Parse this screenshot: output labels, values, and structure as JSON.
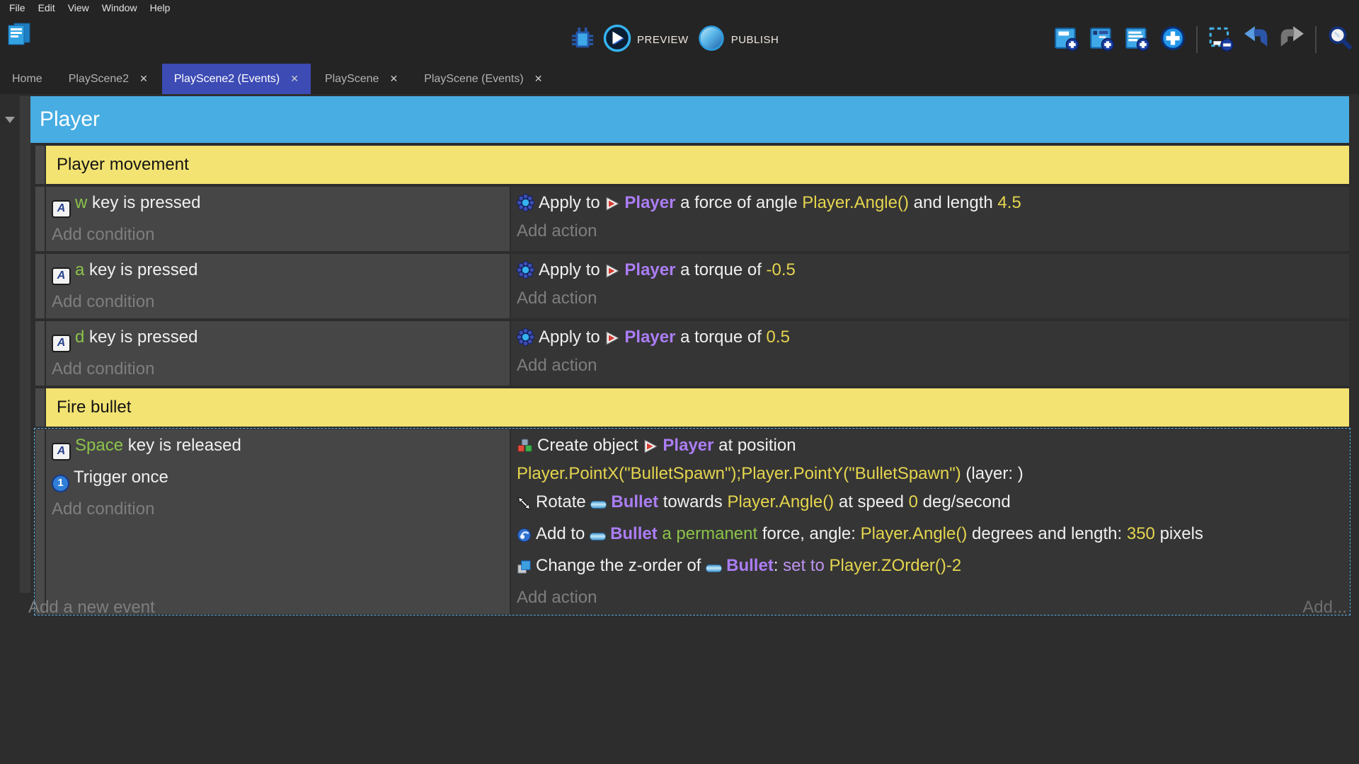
{
  "colors": {
    "group_bar": "#47ade2",
    "comment_bg": "#f3e372",
    "comment_text": "#141414",
    "active_tab": "#3d4bb5",
    "selection": "#5cb6ea",
    "green": "#8bc34a",
    "object_purple": "#ab7df5",
    "expression_yellow": "#e5d54e",
    "operator_violet": "#bd93f0",
    "condition_bg": "#464646",
    "action_bg": "#353535"
  },
  "menu_bar": {
    "items": [
      "File",
      "Edit",
      "View",
      "Window",
      "Help"
    ]
  },
  "toolbar": {
    "preview_label": "PREVIEW",
    "publish_label": "PUBLISH",
    "left_buttons": [
      {
        "name": "project-manager-button",
        "icon": "project-manager"
      }
    ],
    "center_buttons": [
      {
        "name": "debug-button",
        "icon": "debug"
      }
    ],
    "right_icons": [
      {
        "name": "add-event-button",
        "icon": "add-event"
      },
      {
        "name": "add-subevent-button",
        "icon": "add-subevent"
      },
      {
        "name": "add-comment-button",
        "icon": "add-comment"
      },
      {
        "name": "add-new-button",
        "icon": "add-circle"
      },
      {
        "separator": true
      },
      {
        "name": "delete-selection-button",
        "icon": "delete-selection"
      },
      {
        "name": "undo-button",
        "icon": "undo"
      },
      {
        "name": "redo-button",
        "icon": "redo",
        "disabled": true
      },
      {
        "separator": true
      },
      {
        "name": "search-button",
        "icon": "search"
      }
    ]
  },
  "tab_bar": {
    "tabs": [
      {
        "label": "Home",
        "closable": false,
        "active": false
      },
      {
        "label": "PlayScene2",
        "closable": true,
        "active": false
      },
      {
        "label": "PlayScene2 (Events)",
        "closable": true,
        "active": true
      },
      {
        "label": "PlayScene",
        "closable": true,
        "active": false
      },
      {
        "label": "PlayScene (Events)",
        "closable": true,
        "active": false
      }
    ]
  },
  "events_sheet": {
    "add_condition_label": "Add condition",
    "add_action_label": "Add action",
    "add_new_event_label": "Add a new event",
    "add_more_label": "Add...",
    "rows": [
      {
        "type": "group",
        "title": "Player"
      },
      {
        "type": "comment",
        "text": "Player movement"
      },
      {
        "type": "event",
        "selected": false,
        "conditions": [
          {
            "segments": [
              {
                "icon": "keyboard"
              },
              {
                "text": "w",
                "style": "green"
              },
              {
                "text": " key is pressed",
                "style": "plain"
              }
            ]
          }
        ],
        "actions": [
          {
            "segments": [
              {
                "icon": "physics"
              },
              {
                "text": "Apply to ",
                "style": "plain"
              },
              {
                "icon": "player"
              },
              {
                "text": "Player",
                "style": "object"
              },
              {
                "text": " a force of angle ",
                "style": "plain"
              },
              {
                "text": "Player.Angle()",
                "style": "expression"
              },
              {
                "text": " and length ",
                "style": "plain"
              },
              {
                "text": "4.5",
                "style": "expression"
              }
            ]
          }
        ]
      },
      {
        "type": "event",
        "selected": false,
        "conditions": [
          {
            "segments": [
              {
                "icon": "keyboard"
              },
              {
                "text": "a",
                "style": "green"
              },
              {
                "text": " key is pressed",
                "style": "plain"
              }
            ]
          }
        ],
        "actions": [
          {
            "segments": [
              {
                "icon": "physics"
              },
              {
                "text": "Apply to ",
                "style": "plain"
              },
              {
                "icon": "player"
              },
              {
                "text": "Player",
                "style": "object"
              },
              {
                "text": " a torque of ",
                "style": "plain"
              },
              {
                "text": "-0.5",
                "style": "expression"
              }
            ]
          }
        ]
      },
      {
        "type": "event",
        "selected": false,
        "conditions": [
          {
            "segments": [
              {
                "icon": "keyboard"
              },
              {
                "text": "d",
                "style": "green"
              },
              {
                "text": " key is pressed",
                "style": "plain"
              }
            ]
          }
        ],
        "actions": [
          {
            "segments": [
              {
                "icon": "physics"
              },
              {
                "text": "Apply to ",
                "style": "plain"
              },
              {
                "icon": "player"
              },
              {
                "text": "Player",
                "style": "object"
              },
              {
                "text": " a torque of ",
                "style": "plain"
              },
              {
                "text": "0.5",
                "style": "expression"
              }
            ]
          }
        ]
      },
      {
        "type": "comment",
        "text": "Fire bullet"
      },
      {
        "type": "event",
        "selected": true,
        "conditions": [
          {
            "segments": [
              {
                "icon": "keyboard"
              },
              {
                "text": "Space",
                "style": "green"
              },
              {
                "text": " key is released",
                "style": "plain"
              }
            ]
          },
          {
            "segments": [
              {
                "icon": "trigger-once"
              },
              {
                "text": "Trigger once",
                "style": "plain"
              }
            ]
          }
        ],
        "actions": [
          {
            "segments": [
              {
                "icon": "create-object"
              },
              {
                "text": "Create object ",
                "style": "plain"
              },
              {
                "icon": "player"
              },
              {
                "text": "Player",
                "style": "object"
              },
              {
                "text": " at position",
                "style": "plain"
              },
              {
                "break": true
              },
              {
                "text": "Player.PointX(\"BulletSpawn\");Player.PointY(\"BulletSpawn\")",
                "style": "expression"
              },
              {
                "text": " (layer: )",
                "style": "plain"
              }
            ]
          },
          {
            "segments": [
              {
                "icon": "rotate"
              },
              {
                "text": "Rotate ",
                "style": "plain"
              },
              {
                "icon": "bullet"
              },
              {
                "text": "Bullet",
                "style": "object"
              },
              {
                "text": " towards ",
                "style": "plain"
              },
              {
                "text": "Player.Angle()",
                "style": "expression"
              },
              {
                "text": " at speed ",
                "style": "plain"
              },
              {
                "text": "0",
                "style": "expression"
              },
              {
                "text": " deg/second",
                "style": "plain"
              }
            ]
          },
          {
            "segments": [
              {
                "icon": "force"
              },
              {
                "text": "Add to ",
                "style": "plain"
              },
              {
                "icon": "bullet"
              },
              {
                "text": "Bullet",
                "style": "object"
              },
              {
                "text": " ",
                "style": "plain"
              },
              {
                "text": "a permanent",
                "style": "green"
              },
              {
                "text": " force, angle: ",
                "style": "plain"
              },
              {
                "text": "Player.Angle()",
                "style": "expression"
              },
              {
                "text": " degrees and length: ",
                "style": "plain"
              },
              {
                "text": "350",
                "style": "expression"
              },
              {
                "text": " pixels",
                "style": "plain"
              }
            ]
          },
          {
            "segments": [
              {
                "icon": "z-order"
              },
              {
                "text": "Change the z-order of ",
                "style": "plain"
              },
              {
                "icon": "bullet"
              },
              {
                "text": "Bullet",
                "style": "object"
              },
              {
                "text": ": ",
                "style": "plain"
              },
              {
                "text": "set to ",
                "style": "operator"
              },
              {
                "text": "Player.ZOrder()-2",
                "style": "expression"
              }
            ]
          }
        ]
      }
    ]
  }
}
